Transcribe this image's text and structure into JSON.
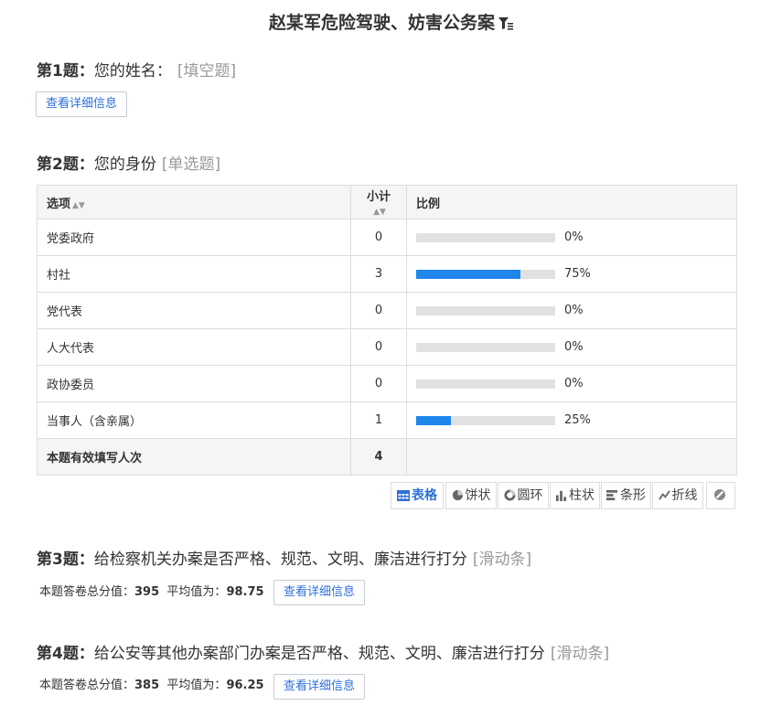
{
  "survey": {
    "title": "赵某军危险驾驶、妨害公务案"
  },
  "q1": {
    "num": "第1题：",
    "text": "您的姓名：",
    "type": "[填空题]",
    "detail_btn": "查看详细信息"
  },
  "q2": {
    "num": "第2题：",
    "text": "您的身份",
    "type": "[单选题]",
    "headers": {
      "option": "选项",
      "count": "小计",
      "ratio": "比例"
    },
    "rows": [
      {
        "option": "党委政府",
        "count": "0",
        "percent": "0%",
        "fill": 0
      },
      {
        "option": "村社",
        "count": "3",
        "percent": "75%",
        "fill": 75
      },
      {
        "option": "党代表",
        "count": "0",
        "percent": "0%",
        "fill": 0
      },
      {
        "option": "人大代表",
        "count": "0",
        "percent": "0%",
        "fill": 0
      },
      {
        "option": "政协委员",
        "count": "0",
        "percent": "0%",
        "fill": 0
      },
      {
        "option": "当事人（含亲属）",
        "count": "1",
        "percent": "25%",
        "fill": 25
      }
    ],
    "total": {
      "label": "本题有效填写人次",
      "count": "4"
    },
    "bar_color": "#1f86ec",
    "views": {
      "table": "表格",
      "pie": "饼状",
      "ring": "圆环",
      "bar": "柱状",
      "hbar": "条形",
      "line": "折线"
    }
  },
  "q3": {
    "num": "第3题：",
    "text": "给检察机关办案是否严格、规范、文明、廉洁进行打分",
    "type": "[滑动条]",
    "total_label": "本题答卷总分值：",
    "total_value": "395",
    "avg_label": "平均值为：",
    "avg_value": "98.75",
    "detail_btn": "查看详细信息"
  },
  "q4": {
    "num": "第4题：",
    "text": "给公安等其他办案部门办案是否严格、规范、文明、廉洁进行打分",
    "type": "[滑动条]",
    "total_label": "本题答卷总分值：",
    "total_value": "385",
    "avg_label": "平均值为：",
    "avg_value": "96.25",
    "detail_btn": "查看详细信息"
  }
}
